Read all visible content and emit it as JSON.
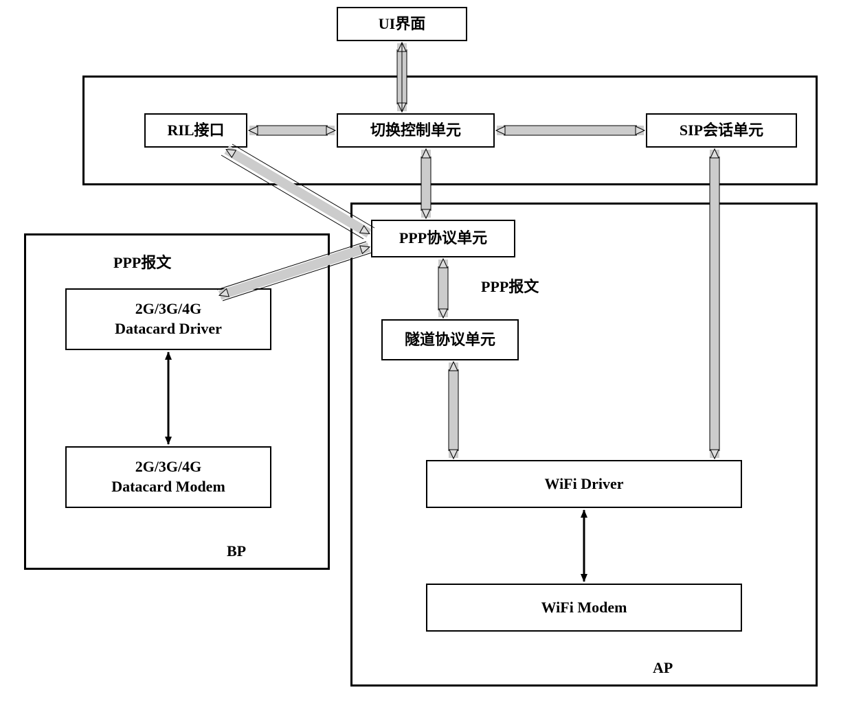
{
  "boxes": {
    "ui": "UI界面",
    "ril": "RIL接口",
    "switchCtrl": "切换控制单元",
    "sip": "SIP会话单元",
    "ppp": "PPP协议单元",
    "tunnel": "隧道协议单元",
    "datacardDriver": "2G/3G/4G\nDatacard Driver",
    "datacardModem": "2G/3G/4G\nDatacard Modem",
    "wifiDriver": "WiFi Driver",
    "wifiModem": "WiFi Modem"
  },
  "labels": {
    "pppMsg1": "PPP报文",
    "pppMsg2": "PPP报文",
    "bp": "BP",
    "ap": "AP"
  }
}
